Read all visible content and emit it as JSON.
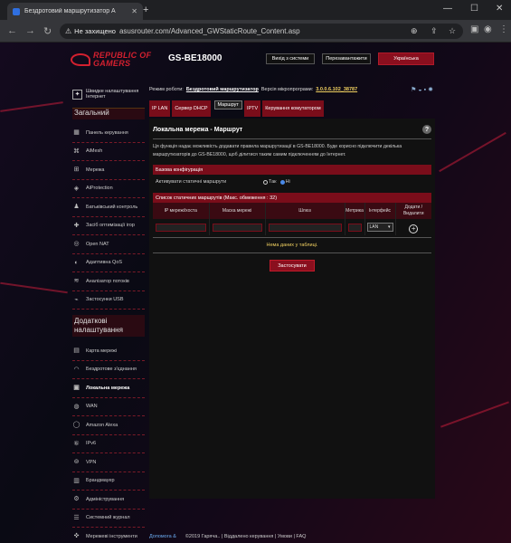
{
  "browser": {
    "tab_title": "Бездротовий маршрутизатор А",
    "url_warning": "Не захищено",
    "url": "asusrouter.com/Advanced_GWStaticRoute_Content.asp"
  },
  "header": {
    "brand_line1": "REPUBLIC OF",
    "brand_line2": "GAMERS",
    "model": "GS-BE18000",
    "logout_label": "Вихід з системи",
    "reboot_label": "Перезавантажити",
    "language": "Українська"
  },
  "sidebar": {
    "quick_setup": "Швидке налаштування Інтернет",
    "general_title": "Загальний",
    "general_items": [
      "Панель керування",
      "AiMesh",
      "Мережа",
      "AiProtection",
      "Батьківський контроль",
      "Засіб оптимізації ігор",
      "Open NAT",
      "Адаптивна QoS",
      "Аналізатор потоків",
      "Застосунки USB"
    ],
    "advanced_title": "Додаткові налаштування",
    "advanced_items": [
      "Карта мережі",
      "Бездротове з'єднання",
      "Локальна мережа",
      "WAN",
      "Amazon Alexa",
      "IPv6",
      "VPN",
      "Брандмауер",
      "Адміністрування",
      "Системний журнал",
      "Мережеві інструменти"
    ]
  },
  "main": {
    "mode_label": "Режим роботи:",
    "mode_value": "Бездротовий маршрутизатор",
    "firmware_label": "Версія мікропрограми:",
    "firmware_value": "3.0.0.6.102_38787",
    "tabs": [
      "IP LAN",
      "Сервер DHCP",
      "Маршрут",
      "IPTV",
      "Керування комутатором"
    ],
    "page_title": "Локальна мережа - Маршрут",
    "description": "Ця функція надає можливість додавати правила маршрутизації в GS-BE18000. Буде корисно підключити декілька маршрутизаторів до GS-BE18000, щоб ділитися таким самим підключенням до Інтернет.",
    "basic_config": "Базова конфігурація",
    "enable_static_label": "Активувати статичні маршрути",
    "radio_yes": "Так",
    "radio_no": "Ні",
    "list_title": "Список статичних маршрутів (Макс. обмеження : 32)",
    "columns": [
      "IP мережі/хоста",
      "Маска мережі",
      "Шлюз",
      "Метрика",
      "Інтерфейс",
      "Додати / Видалити"
    ],
    "interface_value": "LAN",
    "no_data": "Нема даних у таблиці.",
    "apply_label": "Застосувати"
  },
  "footer": {
    "help": "Допомога &",
    "copyright": "©2019 Гаряча.. | Віддалено керування | Умови | FAQ"
  }
}
